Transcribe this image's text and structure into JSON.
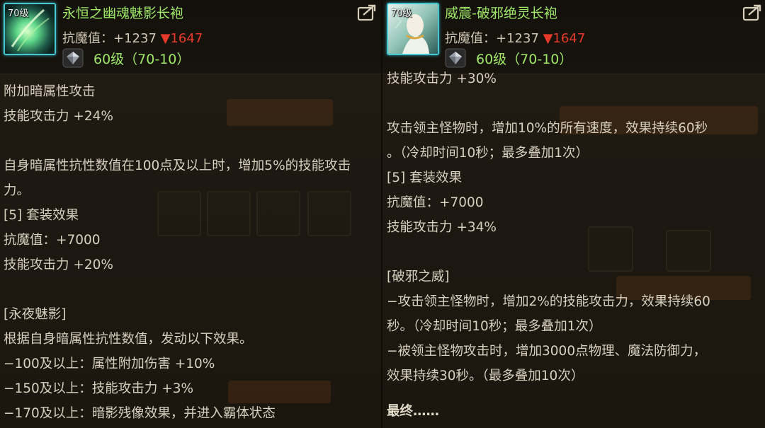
{
  "left": {
    "icon_level": "70级",
    "name": "永恒之幽魂魅影长袍",
    "stat_prefix": "抗魔值：+1237 ",
    "stat_compare": "▼1647",
    "level": "60级（70-10）",
    "lines": [
      "附加暗属性攻击",
      "技能攻击力 +24%",
      "",
      "自身暗属性抗性数值在100点及以上时，增加5%的技能攻击力。",
      "[5] 套装效果",
      "抗魔值：+7000",
      "技能攻击力 +20%",
      "",
      "[永夜魅影]",
      "根据自身暗属性抗性数值，发动以下效果。",
      "−100及以上：属性附加伤害 +10%",
      "−150及以上：技能攻击力 +3%",
      "−170及以上：暗影残像效果，并进入霸体状态"
    ]
  },
  "right": {
    "icon_level": "70级",
    "name": "威震-破邪绝灵长袍",
    "stat_prefix": "抗魔值：+1237 ",
    "stat_compare": "▼1647",
    "level": "60级（70-10）",
    "cut_line": "技能攻击力 +30%",
    "lines": [
      "",
      "攻击领主怪物时，增加10%的所有速度，效果持续60秒",
      "。（冷却时间10秒；最多叠加1次）",
      "[5] 套装效果",
      "抗魔值：+7000",
      "技能攻击力 +34%",
      "",
      "[破邪之威]",
      "−攻击领主怪物时，增加2%的技能攻击力，效果持续60",
      "秒。（冷却时间10秒；最多叠加1次）",
      "−被领主怪物攻击时，增加3000点物理、魔法防御力，",
      "效果持续30秒。（最多叠加10次）",
      ""
    ],
    "final": "最终……"
  },
  "colors": {
    "item_name": "#9fe868",
    "stat_down": "#e83a2a",
    "icon_border": "#47c6cf",
    "body_text": "#d8d0bf"
  },
  "icons": {
    "share": "share-icon",
    "gem": "gem-icon",
    "item": "item-icon"
  }
}
